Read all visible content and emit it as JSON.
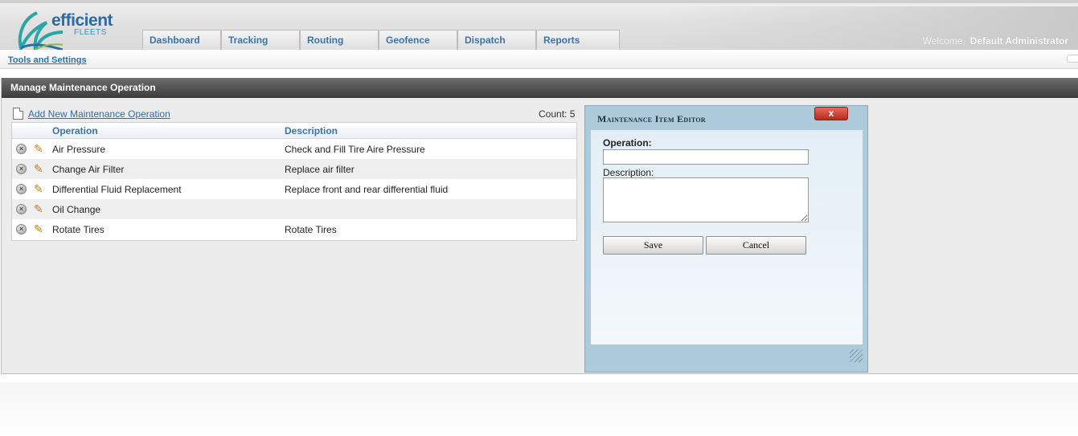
{
  "logo": {
    "name": "efficient",
    "sub": "FLEETS"
  },
  "tabs": [
    {
      "label": "Dashboard"
    },
    {
      "label": "Tracking"
    },
    {
      "label": "Routing"
    },
    {
      "label": "Geofence"
    },
    {
      "label": "Dispatch"
    },
    {
      "label": "Reports"
    }
  ],
  "welcome": {
    "prefix": "Welcome,",
    "user": "Default Administrator"
  },
  "subnav": {
    "link": "Tools and Settings"
  },
  "panel": {
    "title": "Manage Maintenance Operation",
    "add_link": "Add New Maintenance Operation",
    "count_label": "Count: 5"
  },
  "grid": {
    "columns": {
      "operation": "Operation",
      "description": "Description"
    },
    "rows": [
      {
        "operation": "Air Pressure",
        "description": "Check and Fill Tire Aire Pressure"
      },
      {
        "operation": "Change Air Filter",
        "description": "Replace air filter"
      },
      {
        "operation": "Differential Fluid Replacement",
        "description": "Replace front and rear differential fluid"
      },
      {
        "operation": "Oil Change",
        "description": ""
      },
      {
        "operation": "Rotate Tires",
        "description": "Rotate Tires"
      }
    ]
  },
  "dialog": {
    "title": "Maintenance Item Editor",
    "close_label": "x",
    "operation_label": "Operation:",
    "operation_value": "",
    "description_label": "Description:",
    "description_value": "",
    "save_label": "Save",
    "cancel_label": "Cancel"
  },
  "colors": {
    "accent": "#2f6fa8",
    "titlebar": "#3c3c3c",
    "dialog_bg": "#aecbdc",
    "close_red": "#b8291a"
  },
  "icons": {
    "delete": "x-circle-icon",
    "edit": "pencil-icon",
    "doc": "document-icon"
  }
}
